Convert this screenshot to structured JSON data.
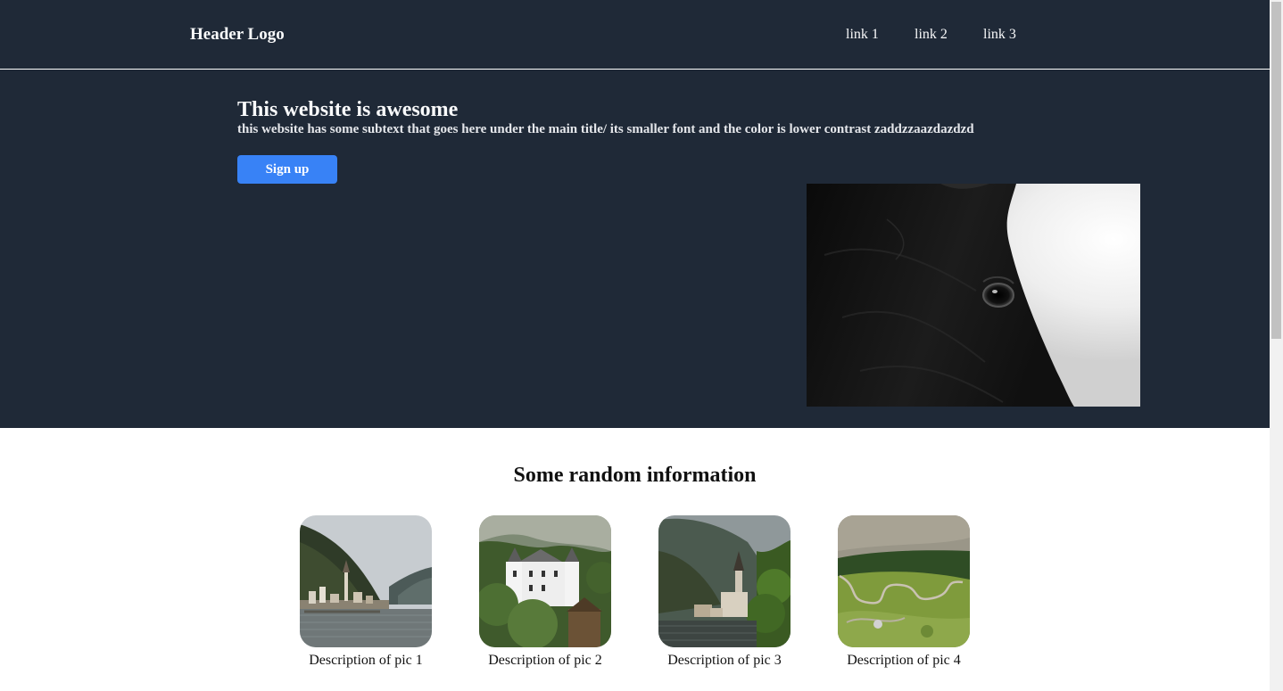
{
  "header": {
    "logo": "Header Logo",
    "links": [
      "link 1",
      "link 2",
      "link 3"
    ]
  },
  "hero": {
    "title": "This website is awesome",
    "subtext": "this website has some subtext that goes here under the main title/ its smaller font and the color is lower contrast zaddzzaazdazdzd",
    "button_label": "Sign up",
    "image": "horse-head-photo"
  },
  "info": {
    "title": "Some random information",
    "cards": [
      {
        "image": "lakeside-village-photo",
        "caption": "Description of pic 1"
      },
      {
        "image": "white-castle-photo",
        "caption": "Description of pic 2"
      },
      {
        "image": "church-lake-photo",
        "caption": "Description of pic 3"
      },
      {
        "image": "mountain-road-photo",
        "caption": "Description of pic 4"
      }
    ]
  },
  "colors": {
    "dark_bg": "#1f2937",
    "button": "#3882f6",
    "text_light": "#f9fafb"
  }
}
